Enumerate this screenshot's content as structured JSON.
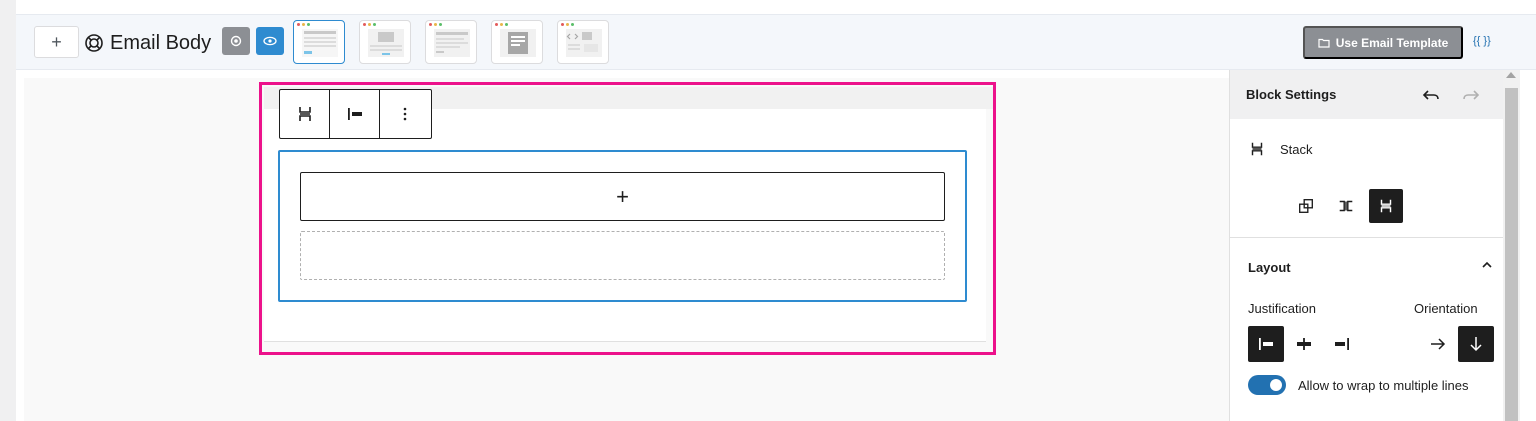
{
  "toolbar": {
    "add_label": "+",
    "title": "Email Body",
    "use_template_label": "Use Email Template",
    "smartcodes_label": "{{ }}"
  },
  "templates": [
    {
      "name": "template-1",
      "active": true
    },
    {
      "name": "template-2",
      "active": false
    },
    {
      "name": "template-3",
      "active": false
    },
    {
      "name": "template-4",
      "active": false
    },
    {
      "name": "template-5",
      "active": false
    }
  ],
  "canvas": {
    "appender_label": "+"
  },
  "panel": {
    "title": "Block Settings",
    "block_name": "Stack",
    "layout_title": "Layout",
    "justification_label": "Justification",
    "orientation_label": "Orientation",
    "wrap_label": "Allow to wrap to multiple lines",
    "wrap_enabled": true
  },
  "colors": {
    "accent": "#2271b1",
    "highlight": "#ec128b",
    "selected_border": "#2e8bd0",
    "use_template_bg": "#8c8f94"
  }
}
